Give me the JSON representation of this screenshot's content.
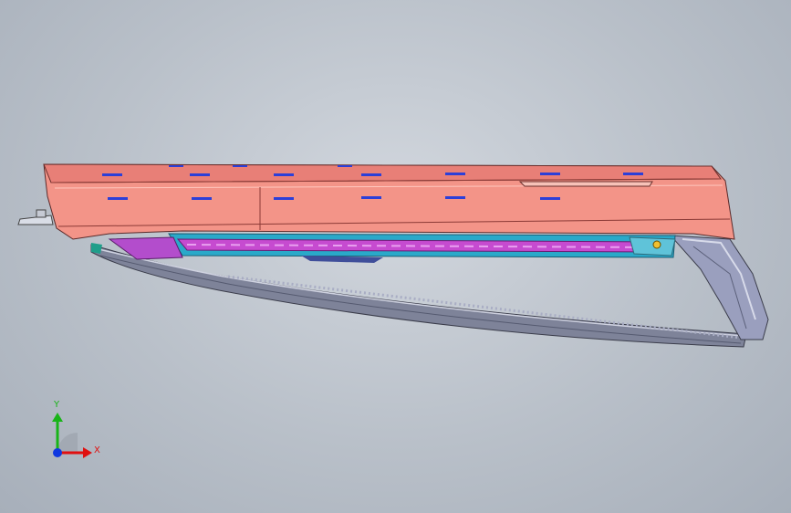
{
  "triad": {
    "x_label": "X",
    "y_label": "Y"
  },
  "colors": {
    "background": "#b9c0c9",
    "hood_shell": "#f29387",
    "hood_dark": "#d9706a",
    "blade_frame": "#8a8fa8",
    "inner_cyan": "#23b9d6",
    "inner_magenta": "#c93fd1",
    "marker_blue": "#2c3fd8",
    "axis_x": "#e01010",
    "axis_y": "#18b418",
    "axis_z": "#1038e0"
  }
}
